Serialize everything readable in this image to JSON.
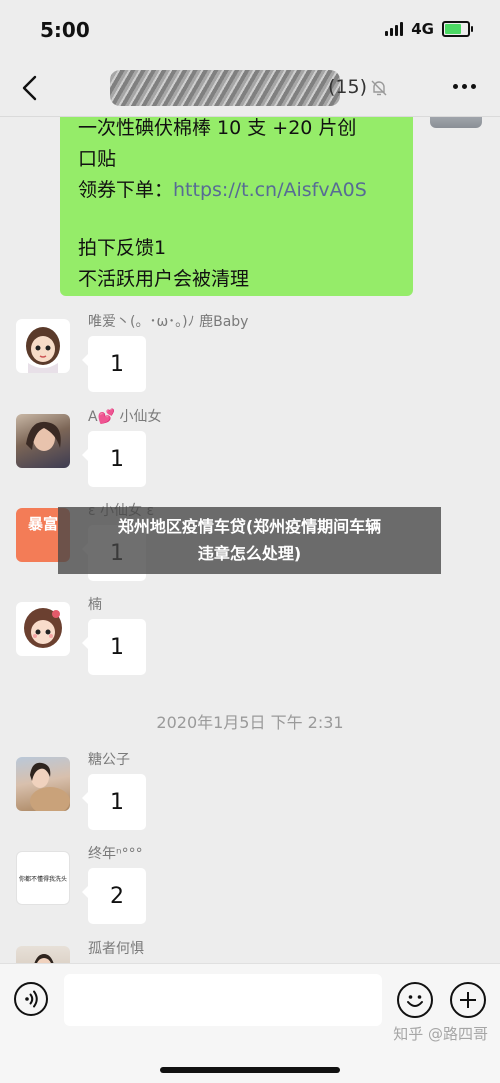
{
  "status_bar": {
    "time": "5:00",
    "network": "4G"
  },
  "header": {
    "member_count": "(15)",
    "mute_icon": "bell-slash-icon",
    "back_icon": "chevron-left-icon",
    "more_icon": "ellipsis-icon"
  },
  "pinned_message": {
    "line1": "一次性碘伏棉棒 10 支 +20 片创",
    "line2": "口贴",
    "line3_prefix": "领券下单：",
    "line3_link": "https://t.cn/AisfvA0S",
    "line4": "拍下反馈1",
    "line5": "不活跃用户会被清理"
  },
  "messages": [
    {
      "sender": "唯爱丶(。･ω･。)ﾉ 鹿Baby",
      "text": "1"
    },
    {
      "sender": "A💕 小仙女",
      "text": "1"
    },
    {
      "sender": "ε 小仙女 ε",
      "text": "1",
      "avatar_text": "暴富"
    },
    {
      "sender": "楠",
      "text": "1"
    },
    {
      "sender": "糖公子",
      "text": "1"
    },
    {
      "sender": "终年ⁿ°°°",
      "text": "2",
      "avatar_text": "你都不懂得我洗头"
    },
    {
      "sender": "孤者何惧",
      "text": ""
    }
  ],
  "timestamp": "2020年1月5日 下午 2:31",
  "overlay_banner": {
    "line1": "郑州地区疫情车贷(郑州疫情期间车辆",
    "line2": "违章怎么处理)"
  },
  "input_bar": {
    "placeholder": "",
    "voice_icon": "voice-icon",
    "emoji_icon": "emoji-icon",
    "plus_icon": "plus-icon"
  },
  "watermark": "知乎 @路四哥",
  "colors": {
    "green_bubble": "#95ec69",
    "link": "#576b95",
    "background": "#ededed"
  }
}
